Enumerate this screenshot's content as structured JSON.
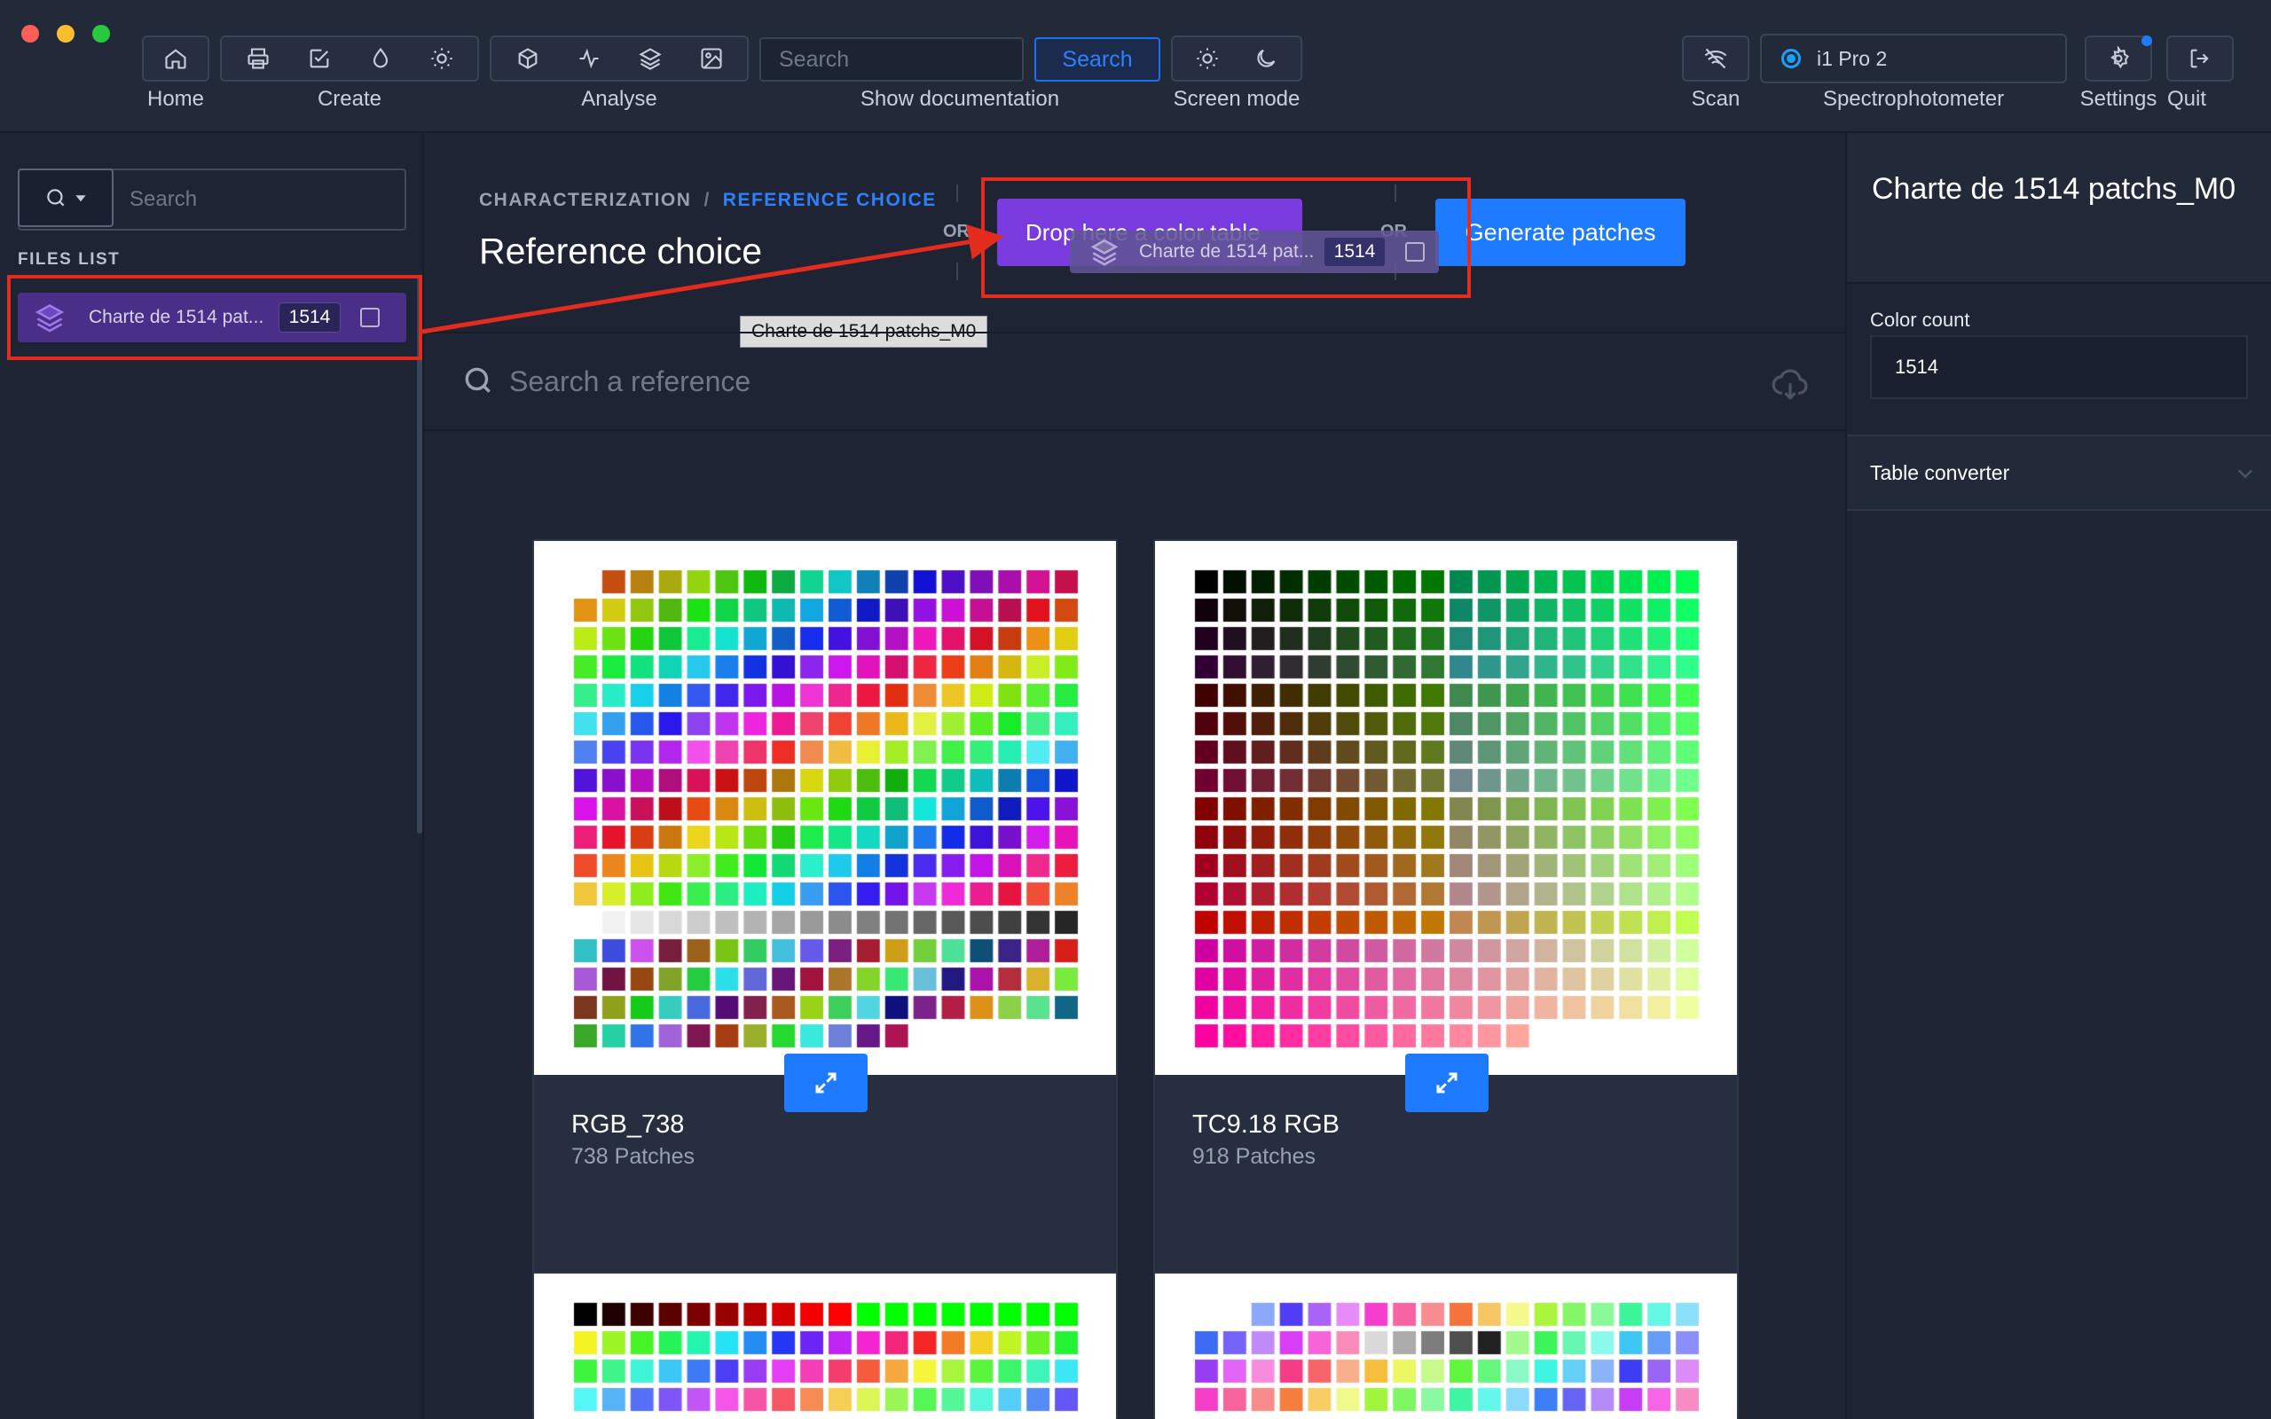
{
  "window": {
    "traffic_lights": [
      "#fe5f57",
      "#febc2e",
      "#28c840"
    ]
  },
  "toolbar": {
    "groups": [
      {
        "label": "Home",
        "icons": [
          "home-icon"
        ]
      },
      {
        "label": "Create",
        "icons": [
          "printer-icon",
          "checkbox-edit-icon",
          "drop-icon",
          "brightness-icon"
        ]
      },
      {
        "label": "Analyse",
        "icons": [
          "cube-icon",
          "activity-icon",
          "layers-icon",
          "image-icon"
        ]
      }
    ],
    "search": {
      "placeholder": "Search",
      "button": "Search",
      "label": "Show documentation"
    },
    "screen_mode": {
      "label": "Screen mode",
      "icons": [
        "sun-icon",
        "moon-icon"
      ]
    },
    "scan": {
      "label": "Scan",
      "icon": "scan-off-icon"
    },
    "spectrophotometer": {
      "label": "Spectrophotometer",
      "device": "i1 Pro 2"
    },
    "settings": {
      "label": "Settings",
      "icon": "gear-icon"
    },
    "quit": {
      "label": "Quit",
      "icon": "logout-icon"
    }
  },
  "sidebar": {
    "search_placeholder": "Search",
    "section_title": "FILES LIST",
    "files": [
      {
        "name": "Charte de 1514 patchs_M0",
        "display": "Charte de 1514 pat...",
        "count": "1514"
      }
    ]
  },
  "main": {
    "breadcrumb": [
      "CHARACTERIZATION",
      "/",
      "REFERENCE CHOICE"
    ],
    "title": "Reference choice",
    "or_label": "OR",
    "or_label_2": "OR",
    "drop_zone": "Drop here a color table",
    "generate_button": "Generate patches",
    "drag_ghost": {
      "name": "Charte de 1514 pat...",
      "count": "1514"
    },
    "tooltip": "Charte de 1514 patchs_M0",
    "search_placeholder": "Search a reference",
    "cards": [
      {
        "name": "RGB_738",
        "patches": "738 Patches"
      },
      {
        "name": "TC9.18 RGB",
        "patches": "918 Patches"
      },
      {
        "name": "",
        "patches": ""
      },
      {
        "name": "",
        "patches": ""
      }
    ]
  },
  "right_panel": {
    "title": "Charte de 1514 patchs_M0",
    "color_count_label": "Color count",
    "color_count_value": "1514",
    "table_converter": "Table converter"
  },
  "colors": {
    "accent_blue": "#1e7bff",
    "drop_purple": "#7a3bde",
    "file_selected": "#4a2f88",
    "annotation_red": "#e32b1e"
  }
}
